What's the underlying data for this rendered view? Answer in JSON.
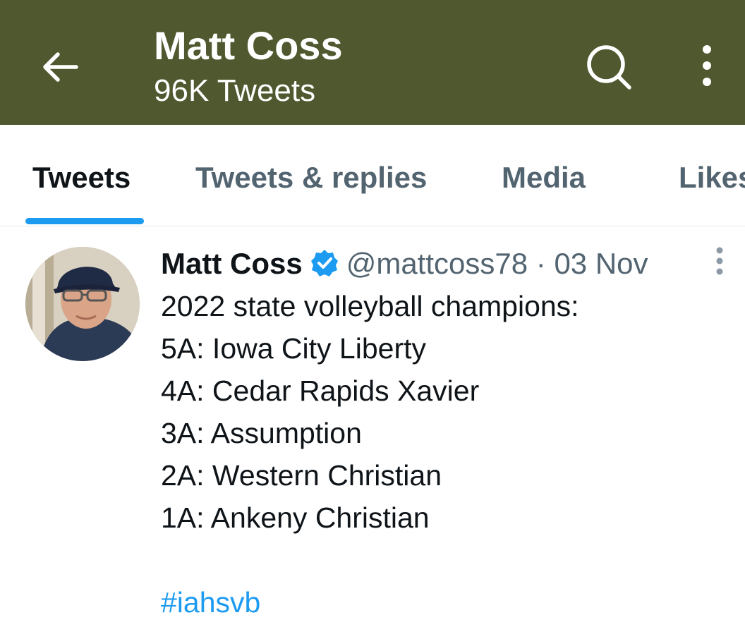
{
  "header": {
    "title": "Matt Coss",
    "subtitle": "96K Tweets",
    "background": "#4f582e"
  },
  "icons": {
    "back": "arrow-left-icon",
    "search": "search-icon",
    "more": "more-vertical-icon"
  },
  "tabs": [
    {
      "label": "Tweets",
      "active": true
    },
    {
      "label": "Tweets & replies",
      "active": false
    },
    {
      "label": "Media",
      "active": false
    },
    {
      "label": "Likes",
      "active": false
    }
  ],
  "tweet": {
    "author_name": "Matt Coss",
    "handle": "@mattcoss78",
    "separator": "·",
    "date": "03 Nov",
    "lines": [
      "2022 state volleyball champions:",
      "5A: Iowa City Liberty",
      "4A: Cedar Rapids Xavier",
      "3A: Assumption",
      "2A: Western Christian",
      "1A: Ankeny Christian"
    ],
    "hashtag": "#iahsvb"
  },
  "colors": {
    "accent": "#1d9bf0",
    "secondary_text": "#536471"
  }
}
